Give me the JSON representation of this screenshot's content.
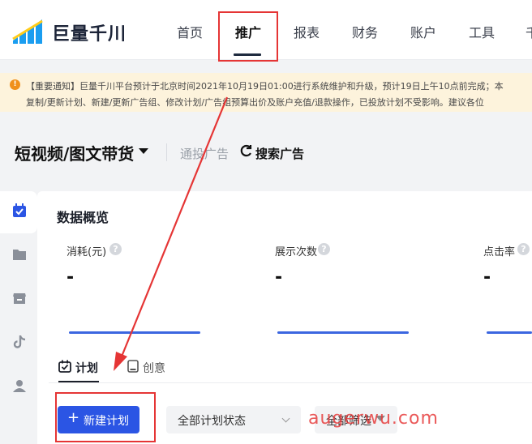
{
  "brand": {
    "name": "巨量千川"
  },
  "nav": {
    "items": [
      "首页",
      "推广",
      "报表",
      "财务",
      "账户",
      "工具",
      "千"
    ],
    "active": "推广"
  },
  "notice": {
    "line1": "【重要通知】巨量千川平台预计于北京时间2021年10月19日01:00进行系统维护和升级，预计19日上午10点前完成；本",
    "line2": "复制/更新计划、新建/更新广告组、修改计划/广告组预算出价及账户充值/退款操作，已投放计划不受影响。建议各位"
  },
  "header": {
    "title": "短视频/图文带货",
    "tab_normal": "通投广告",
    "tab_search": "搜索广告"
  },
  "overview": {
    "title": "数据概览",
    "metrics": [
      {
        "label": "消耗(元)",
        "value": "-"
      },
      {
        "label": "展示次数",
        "value": "-"
      },
      {
        "label": "点击率",
        "value": "-"
      }
    ]
  },
  "subtabs": {
    "plan": "计划",
    "creative": "创意"
  },
  "toolbar": {
    "new_plan": "新建计划",
    "status_select": "全部计划状态",
    "filter": "全部筛选"
  },
  "watermark": "augerwu.com",
  "colors": {
    "primary": "#2b55e4",
    "annotation": "#e53535",
    "notice_bg": "#fdf3dc"
  }
}
